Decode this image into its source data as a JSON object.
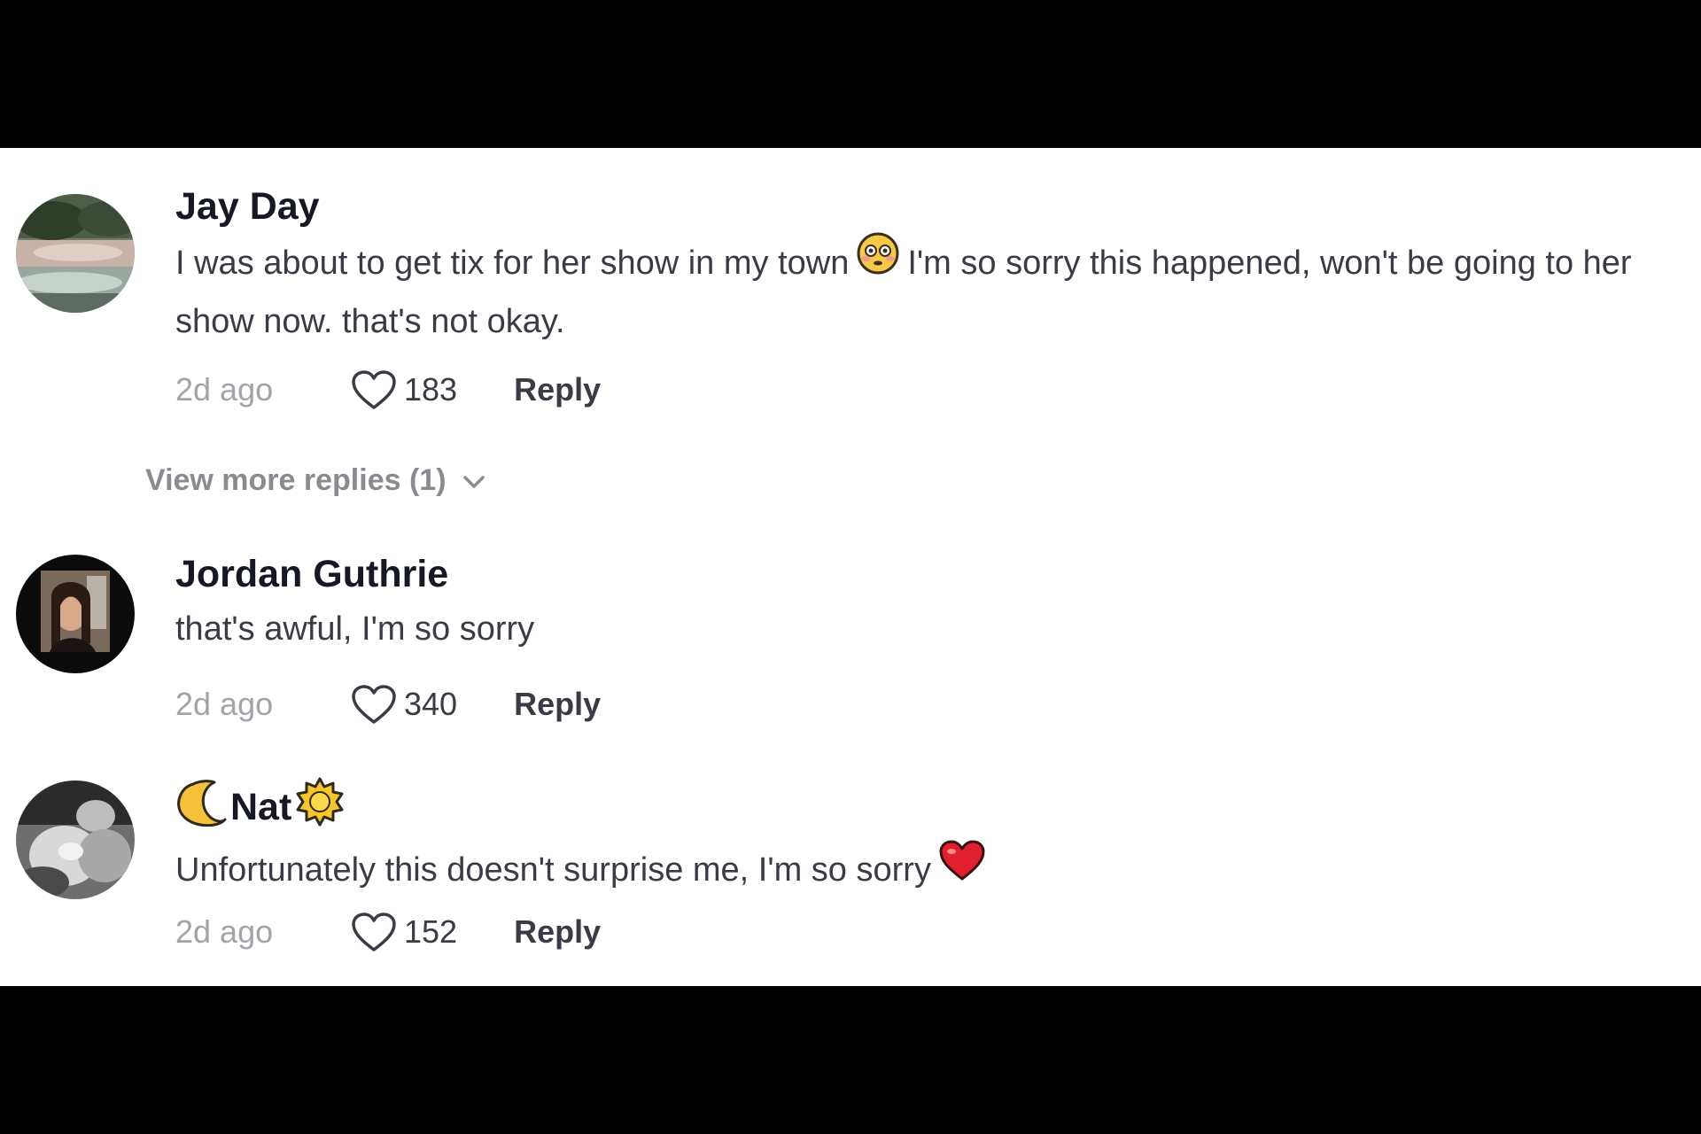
{
  "comments": [
    {
      "username": "Jay Day",
      "text_before_emoji": "I was about to get tix for her show in my town",
      "emoji": "flushed-face",
      "text_after_emoji": "I'm so sorry this happened, won't be going to her show now. that's not okay.",
      "time": "2d ago",
      "likes": "183",
      "reply_label": "Reply"
    },
    {
      "username": "Jordan Guthrie",
      "text": "that's awful, I'm so sorry",
      "time": "2d ago",
      "likes": "340",
      "reply_label": "Reply"
    },
    {
      "username_prefix_emoji": "crescent-moon",
      "username": "Nat",
      "username_suffix_emoji": "sun",
      "text": "Unfortunately this doesn't surprise me, I'm so sorry",
      "trailing_emoji": "red-heart",
      "time": "2d ago",
      "likes": "152",
      "reply_label": "Reply"
    }
  ],
  "view_more": {
    "label": "View more replies (1)",
    "icon": "chevron-down-icon"
  },
  "colors": {
    "username": "#161823",
    "body_text": "#3a3b44",
    "timestamp": "#a3a4a9",
    "view_more": "#8a8b91",
    "letterbox": "#000000",
    "panel": "#ffffff"
  }
}
